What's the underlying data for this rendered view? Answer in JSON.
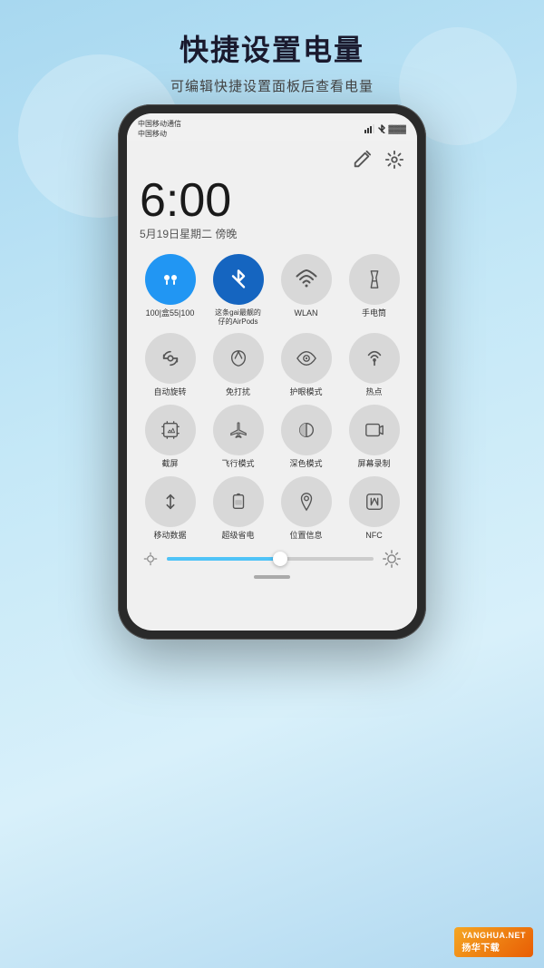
{
  "page": {
    "title": "快捷设置电量",
    "subtitle": "可编辑快捷设置面板后查看电量",
    "background_colors": [
      "#a8d8f0",
      "#c5e8f7",
      "#d8f0fa"
    ]
  },
  "status_bar": {
    "carrier1": "中国移动通信",
    "carrier2": "中国移动",
    "time": "6:00",
    "date": "5月19日星期二 傍晚"
  },
  "toggles": [
    {
      "id": "airpods",
      "label": "100|盒55|100",
      "active": true,
      "color": "blue"
    },
    {
      "id": "bluetooth",
      "label": "这条gai最靓的\n仔的AirPods",
      "active": true,
      "color": "blue2"
    },
    {
      "id": "wifi",
      "label": "WLAN",
      "active": false
    },
    {
      "id": "flashlight",
      "label": "手电筒",
      "active": false
    },
    {
      "id": "rotate",
      "label": "自动旋转",
      "active": false
    },
    {
      "id": "dnd",
      "label": "免打扰",
      "active": false
    },
    {
      "id": "eyeprotect",
      "label": "护眼模式",
      "active": false
    },
    {
      "id": "hotspot",
      "label": "热点",
      "active": false
    },
    {
      "id": "screenshot",
      "label": "截屏",
      "active": false
    },
    {
      "id": "airplane",
      "label": "飞行模式",
      "active": false
    },
    {
      "id": "darkmode",
      "label": "深色模式",
      "active": false
    },
    {
      "id": "screenrecord",
      "label": "屏幕录制",
      "active": false
    },
    {
      "id": "mobiledata",
      "label": "移动数据",
      "active": false
    },
    {
      "id": "powersave",
      "label": "超级省电",
      "active": false
    },
    {
      "id": "location",
      "label": "位置信息",
      "active": false
    },
    {
      "id": "nfc",
      "label": "NFC",
      "active": false
    }
  ],
  "brightness": {
    "value": 55,
    "min_icon": "sun-small",
    "max_icon": "sun-large"
  },
  "watermark": {
    "site": "YANGHUA.NET",
    "label": "扬华下载"
  }
}
